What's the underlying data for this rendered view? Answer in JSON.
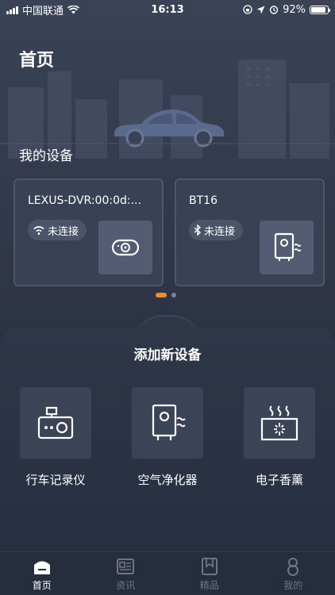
{
  "status_bar": {
    "carrier": "中国联通",
    "time": "16:13",
    "battery": "92%",
    "battery_level": 0.92
  },
  "page": {
    "title": "首页",
    "my_devices_title": "我的设备"
  },
  "devices": [
    {
      "name": "LEXUS-DVR:00:0d:...",
      "status": "未连接",
      "connection_icon": "wifi-icon",
      "thumb_icon": "dashcam-icon"
    },
    {
      "name": "BT16",
      "status": "未连接",
      "connection_icon": "bluetooth-icon",
      "thumb_icon": "air-purifier-icon"
    }
  ],
  "carousel": {
    "pages": 2,
    "active_index": 0
  },
  "add_section": {
    "title": "添加新设备",
    "items": [
      {
        "label": "行车记录仪",
        "icon": "camera-recorder-icon"
      },
      {
        "label": "空气净化器",
        "icon": "air-purifier-icon"
      },
      {
        "label": "电子香薰",
        "icon": "aroma-diffuser-icon"
      }
    ]
  },
  "tabbar": {
    "tabs": [
      {
        "label": "首页",
        "icon": "home-icon",
        "active": true
      },
      {
        "label": "资讯",
        "icon": "news-icon",
        "active": false
      },
      {
        "label": "精品",
        "icon": "bookmark-icon",
        "active": false
      },
      {
        "label": "我的",
        "icon": "profile-icon",
        "active": false
      }
    ]
  },
  "colors": {
    "background": "#2a3142",
    "card": "#394155",
    "accent": "#f28c28",
    "inactive_tab": "#6e7588"
  }
}
